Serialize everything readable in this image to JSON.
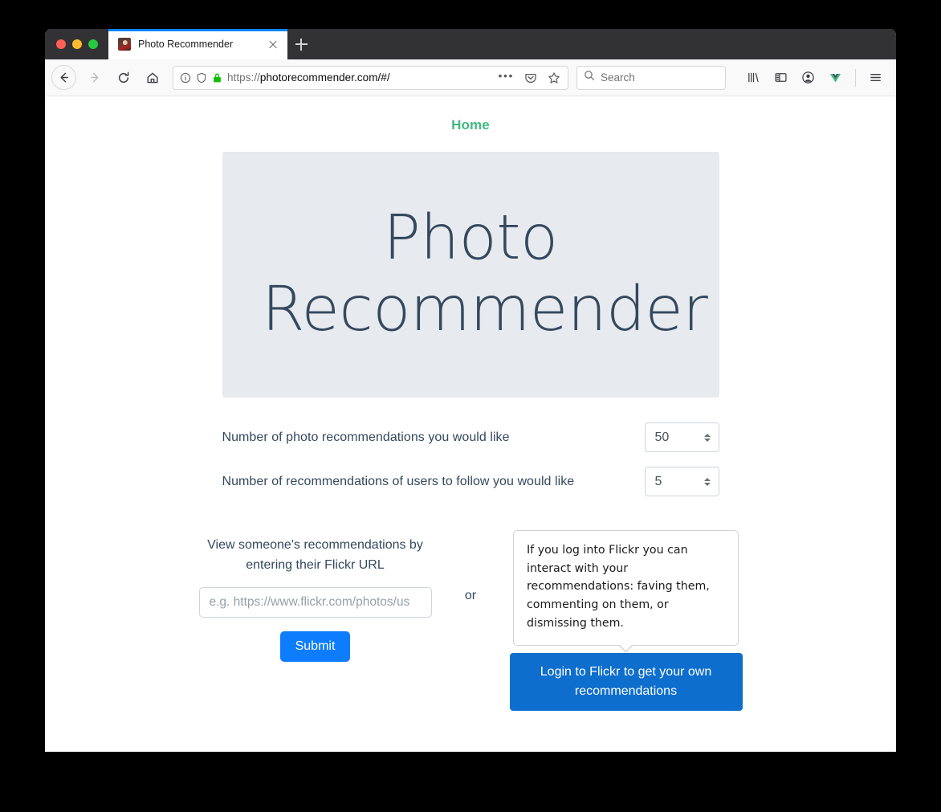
{
  "browser": {
    "tab": {
      "title": "Photo Recommender",
      "favicon_name": "photo-favicon",
      "close_label": "×"
    },
    "new_tab_label": "+",
    "nav": {
      "back_label": "←",
      "forward_label": "→",
      "reload_label": "⟳",
      "home_label": "⌂"
    },
    "urlbar": {
      "scheme": "https://",
      "host_path": "photorecommender.com/#/",
      "info_icon": "info-icon",
      "tracking_icon": "shield-icon",
      "lock_icon": "lock-icon",
      "page_actions_label": "•••",
      "pocket_icon": "pocket-icon",
      "bookmark_icon": "star-icon"
    },
    "search": {
      "placeholder": "Search",
      "icon": "search-icon"
    },
    "toolbar_icons": [
      {
        "name": "library-icon",
        "glyph": "library"
      },
      {
        "name": "sidebar-icon",
        "glyph": "sidebar"
      },
      {
        "name": "account-icon",
        "glyph": "account"
      },
      {
        "name": "vue-devtools-icon",
        "glyph": "vue"
      },
      {
        "name": "menu-icon",
        "glyph": "hamburger"
      }
    ]
  },
  "page": {
    "nav_home": "Home",
    "banner_title": "Photo Recommender",
    "form_rows": [
      {
        "label": "Number of photo recommendations you would like",
        "value": "50"
      },
      {
        "label": "Number of recommendations of users to follow you would like",
        "value": "5"
      }
    ],
    "left": {
      "caption": "View someone's recommendations by entering their Flickr URL",
      "input_placeholder": "e.g. https://www.flickr.com/photos/us",
      "submit_label": "Submit"
    },
    "or_label": "or",
    "right": {
      "tooltip": "If you log into Flickr you can interact with your recommendations: faving them, commenting on them, or dismissing them.",
      "login_label": "Login to Flickr to get your own recommendations"
    }
  },
  "colors": {
    "accent_green": "#42b983",
    "banner_bg": "#e7eaee",
    "banner_text": "#34495e",
    "submit_blue": "#0d7dfd",
    "login_blue": "#0d6ecd",
    "tab_active_border": "#0a84ff"
  }
}
